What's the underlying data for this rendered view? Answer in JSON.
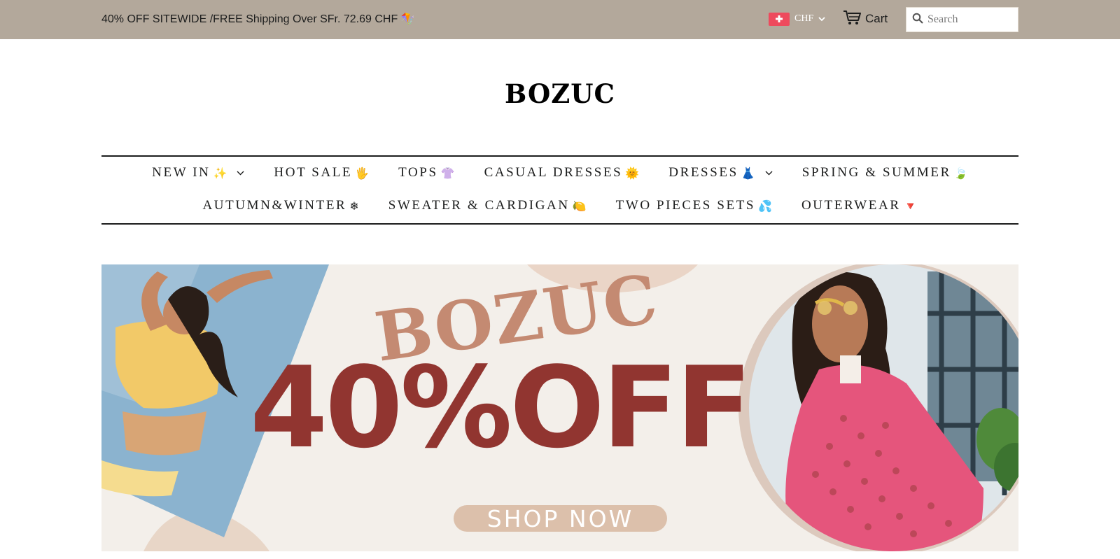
{
  "topbar": {
    "announcement": "40% OFF SITEWIDE /FREE Shipping Over SFr. 72.69 CHF 🪁",
    "currency": {
      "code": "CHF",
      "flag_icon": "swiss-flag-icon"
    },
    "cart_label": "Cart",
    "search_placeholder": "Search",
    "background": "#b3a89b"
  },
  "logo": "BOZUC",
  "nav": {
    "row1": [
      {
        "label": "NEW IN",
        "emoji": "✨",
        "has_dropdown": true
      },
      {
        "label": "HOT SALE",
        "emoji": "🖐",
        "has_dropdown": false
      },
      {
        "label": "TOPS",
        "emoji": "👚",
        "has_dropdown": false
      },
      {
        "label": "CASUAL DRESSES",
        "emoji": "🌞",
        "has_dropdown": false
      },
      {
        "label": "DRESSES",
        "emoji": "👗",
        "has_dropdown": true
      },
      {
        "label": "SPRING & SUMMER",
        "emoji": "🍃",
        "has_dropdown": false
      }
    ],
    "row2": [
      {
        "label": "AUTUMN&WINTER",
        "emoji": "❄",
        "has_dropdown": false
      },
      {
        "label": "SWEATER & CARDIGAN",
        "emoji": "🍋",
        "has_dropdown": false
      },
      {
        "label": "TWO PIECES SETS",
        "emoji": "💦",
        "has_dropdown": false
      },
      {
        "label": "OUTERWEAR",
        "emoji": "🔻",
        "has_dropdown": false
      }
    ]
  },
  "hero": {
    "brand": "BOZUC",
    "offer": "40%OFF",
    "cta": "SHOP NOW",
    "colors": {
      "brand": "#c48a72",
      "offer": "#913530",
      "cta_bg": "#dcc0ab",
      "background": "#f3efea"
    }
  }
}
